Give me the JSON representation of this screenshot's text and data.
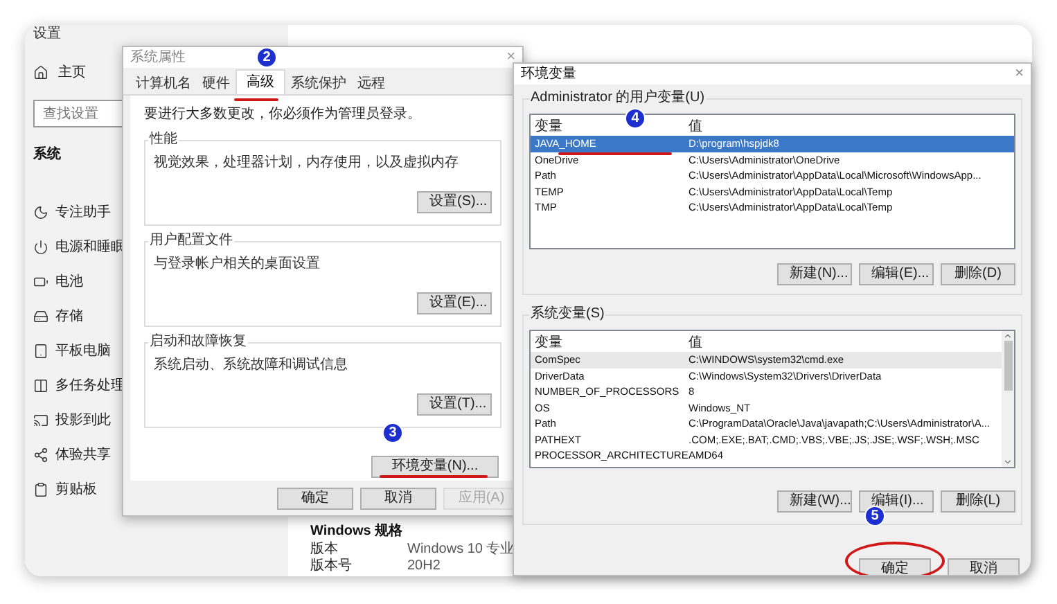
{
  "settings": {
    "title": "设置",
    "home": {
      "label": "主页",
      "kind": "home"
    },
    "search": {
      "placeholder": "查找设置"
    },
    "section": "系统",
    "items": [
      {
        "label": "专注助手",
        "kind": "moon"
      },
      {
        "label": "电源和睡眠",
        "kind": "power"
      },
      {
        "label": "电池",
        "kind": "battery"
      },
      {
        "label": "存储",
        "kind": "storage"
      },
      {
        "label": "平板电脑",
        "kind": "tablet"
      },
      {
        "label": "多任务处理",
        "kind": "multitask"
      },
      {
        "label": "投影到此",
        "kind": "project"
      },
      {
        "label": "体验共享",
        "kind": "share"
      },
      {
        "label": "剪贴板",
        "kind": "clipboard"
      }
    ],
    "specs": {
      "heading": "Windows 规格",
      "rows": [
        {
          "label": "版本",
          "value": "Windows 10 专业"
        },
        {
          "label": "版本号",
          "value": "20H2"
        }
      ]
    }
  },
  "system_properties": {
    "title": "系统属性",
    "close": "×",
    "tabs": [
      {
        "label": "计算机名",
        "selected": false
      },
      {
        "label": "硬件",
        "selected": false
      },
      {
        "label": "高级",
        "selected": true,
        "callout": "2",
        "underlined": true
      },
      {
        "label": "系统保护",
        "selected": false
      },
      {
        "label": "远程",
        "selected": false
      }
    ],
    "notice": "要进行大多数更改，你必须作为管理员登录。",
    "groups": [
      {
        "title": "性能",
        "text": "视觉效果，处理器计划，内存使用，以及虚拟内存",
        "button": "设置(S)..."
      },
      {
        "title": "用户配置文件",
        "text": "与登录帐户相关的桌面设置",
        "button": "设置(E)..."
      },
      {
        "title": "启动和故障恢复",
        "text": "系统启动、系统故障和调试信息",
        "button": "设置(T)..."
      }
    ],
    "env_button": {
      "label": "环境变量(N)...",
      "callout": "3",
      "underlined": true
    },
    "buttons": [
      {
        "label": "确定",
        "disabled": false
      },
      {
        "label": "取消",
        "disabled": false
      },
      {
        "label": "应用(A)",
        "disabled": true
      }
    ]
  },
  "environment_variables": {
    "title": "环境变量",
    "close": "×",
    "user_section": {
      "title": "Administrator 的用户变量(U)",
      "callout": "4",
      "columns": [
        "变量",
        "值"
      ],
      "rows": [
        {
          "name": "JAVA_HOME",
          "value": "D:\\program\\hspjdk8",
          "selected": true,
          "underlined": true
        },
        {
          "name": "OneDrive",
          "value": "C:\\Users\\Administrator\\OneDrive",
          "selected": false,
          "underlined": false
        },
        {
          "name": "Path",
          "value": "C:\\Users\\Administrator\\AppData\\Local\\Microsoft\\WindowsApp...",
          "selected": false,
          "underlined": false
        },
        {
          "name": "TEMP",
          "value": "C:\\Users\\Administrator\\AppData\\Local\\Temp",
          "selected": false,
          "underlined": false
        },
        {
          "name": "TMP",
          "value": "C:\\Users\\Administrator\\AppData\\Local\\Temp",
          "selected": false,
          "underlined": false
        }
      ],
      "buttons": [
        "新建(N)...",
        "编辑(E)...",
        "删除(D)"
      ]
    },
    "system_section": {
      "title": "系统变量(S)",
      "columns": [
        "变量",
        "值"
      ],
      "rows": [
        {
          "name": "ComSpec",
          "value": "C:\\WINDOWS\\system32\\cmd.exe",
          "selected": true
        },
        {
          "name": "DriverData",
          "value": "C:\\Windows\\System32\\Drivers\\DriverData",
          "selected": false
        },
        {
          "name": "NUMBER_OF_PROCESSORS",
          "value": "8",
          "selected": false
        },
        {
          "name": "OS",
          "value": "Windows_NT",
          "selected": false
        },
        {
          "name": "Path",
          "value": "C:\\ProgramData\\Oracle\\Java\\javapath;C:\\Users\\Administrator\\A...",
          "selected": false
        },
        {
          "name": "PATHEXT",
          "value": ".COM;.EXE;.BAT;.CMD;.VBS;.VBE;.JS;.JSE;.WSF;.WSH;.MSC",
          "selected": false
        },
        {
          "name": "PROCESSOR_ARCHITECTURE",
          "value": "AMD64",
          "selected": false
        }
      ],
      "buttons": [
        {
          "label": "新建(W)..."
        },
        {
          "label": "编辑(I)...",
          "callout": "5"
        },
        {
          "label": "删除(L)"
        }
      ]
    },
    "buttons": [
      {
        "label": "确定",
        "circled": true
      },
      {
        "label": "取消",
        "circled": false
      }
    ]
  }
}
